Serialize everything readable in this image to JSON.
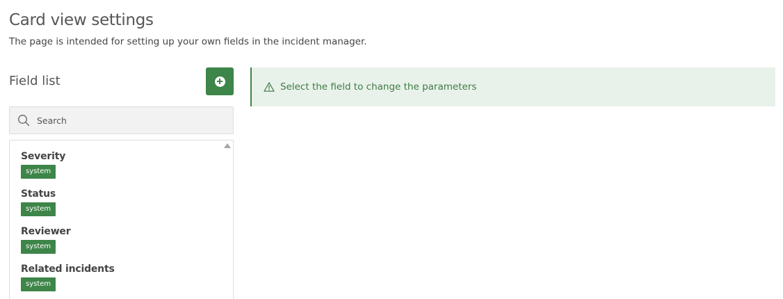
{
  "header": {
    "title": "Card view settings",
    "subtitle": "The page is intended for setting up your own fields in the incident manager."
  },
  "sidebar": {
    "title": "Field list",
    "search": {
      "placeholder": "Search",
      "value": ""
    },
    "items": [
      {
        "name": "Severity",
        "badge": "system"
      },
      {
        "name": "Status",
        "badge": "system"
      },
      {
        "name": "Reviewer",
        "badge": "system"
      },
      {
        "name": "Related incidents",
        "badge": "system"
      }
    ]
  },
  "main": {
    "notice": "Select the field to change the parameters"
  },
  "icons": {
    "add": "plus-circle-icon",
    "search": "search-icon",
    "notice": "warning-triangle-icon",
    "scroll": "scroll-up-arrow-icon"
  },
  "colors": {
    "accent": "#3d8548",
    "notice_background": "#e9f2ea",
    "notice_text": "#3d7a45"
  }
}
